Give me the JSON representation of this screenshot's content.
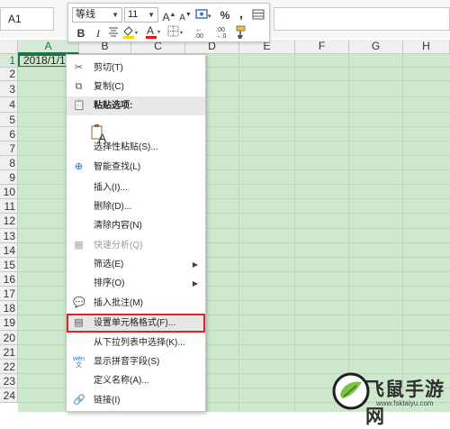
{
  "namebox": {
    "value": "A1"
  },
  "mini_toolbar": {
    "font_name": "等线",
    "font_size": "11",
    "increase_font": "A",
    "decrease_font": "A",
    "percent": "%",
    "comma": ",",
    "bold": "B",
    "italic": "I",
    "font_color_letter": "A",
    "increase_decimal": ".00",
    "decrease_decimal": ".00",
    "highlight_color": "#f5d800",
    "font_color": "#e0151b"
  },
  "columns": [
    "A",
    "B",
    "C",
    "D",
    "E",
    "F",
    "G",
    "H"
  ],
  "rows": [
    "1",
    "2",
    "3",
    "4",
    "5",
    "6",
    "7",
    "8",
    "9",
    "10",
    "11",
    "12",
    "13",
    "14",
    "15",
    "16",
    "17",
    "18",
    "19",
    "20",
    "21",
    "22",
    "23",
    "24"
  ],
  "cells": {
    "A1": "2018/1/1"
  },
  "context_menu": {
    "items": [
      {
        "label": "剪切(T)",
        "icon": "scissors-icon"
      },
      {
        "label": "复制(C)",
        "icon": "copy-icon"
      },
      {
        "label": "粘贴选项:",
        "icon": "paste-icon"
      },
      {
        "label": "",
        "icon": "paste-text-only-icon"
      },
      {
        "label": "选择性粘贴(S)...",
        "icon": ""
      },
      {
        "label": "智能查找(L)",
        "icon": "smart-lookup-icon"
      },
      {
        "label": "插入(I)...",
        "icon": ""
      },
      {
        "label": "删除(D)...",
        "icon": ""
      },
      {
        "label": "清除内容(N)",
        "icon": ""
      },
      {
        "label": "快速分析(Q)",
        "icon": "quick-analysis-icon"
      },
      {
        "label": "筛选(E)",
        "icon": ""
      },
      {
        "label": "排序(O)",
        "icon": ""
      },
      {
        "label": "插入批注(M)",
        "icon": "insert-comment-icon"
      },
      {
        "label": "设置单元格格式(F)...",
        "icon": "format-cells-icon"
      },
      {
        "label": "从下拉列表中选择(K)...",
        "icon": ""
      },
      {
        "label": "显示拼音字段(S)",
        "icon": "phonetic-icon"
      },
      {
        "label": "定义名称(A)...",
        "icon": ""
      },
      {
        "label": "链接(I)",
        "icon": "link-icon"
      }
    ],
    "paste_big_letter": "A",
    "highlight_border_color": "#d9262c"
  },
  "watermark": {
    "name": "飞鼠手游网",
    "url": "www.fsktaiyu.com"
  },
  "colors": {
    "sheet_bg": "#cde8cd",
    "gridline": "#b9d9b9",
    "selection": "#217346"
  }
}
